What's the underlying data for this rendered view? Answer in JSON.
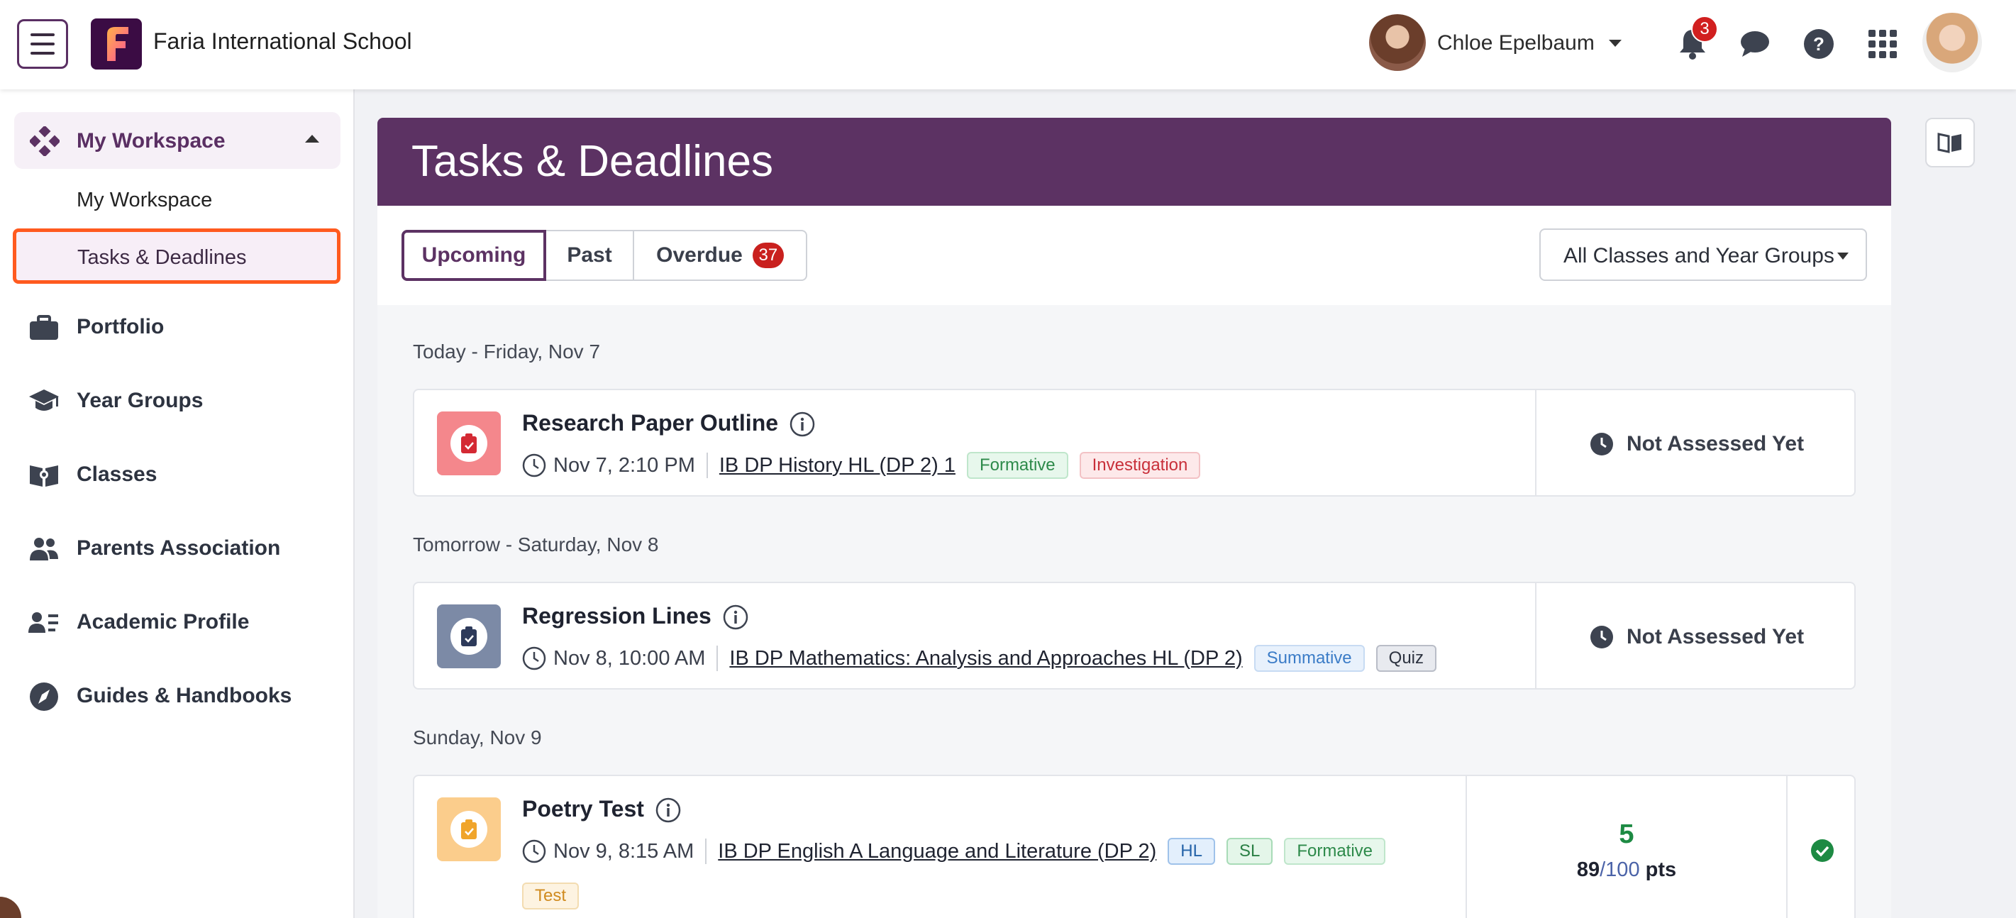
{
  "header": {
    "school_name": "Faria International School",
    "user_name": "Chloe Epelbaum",
    "notification_count": "3"
  },
  "sidebar": {
    "workspace_title": "My Workspace",
    "sub_items": [
      "My Workspace",
      "Tasks & Deadlines"
    ],
    "items": [
      {
        "label": "Portfolio",
        "icon": "briefcase-icon"
      },
      {
        "label": "Year Groups",
        "icon": "graduation-cap-icon"
      },
      {
        "label": "Classes",
        "icon": "book-open-icon"
      },
      {
        "label": "Parents Association",
        "icon": "users-icon"
      },
      {
        "label": "Academic Profile",
        "icon": "id-card-icon"
      },
      {
        "label": "Guides & Handbooks",
        "icon": "compass-icon"
      }
    ]
  },
  "page": {
    "title": "Tasks & Deadlines",
    "tabs": [
      {
        "label": "Upcoming"
      },
      {
        "label": "Past"
      },
      {
        "label": "Overdue",
        "count": "37"
      }
    ],
    "filter": "All Classes and Year Groups"
  },
  "groups": [
    {
      "day": "Today - Friday, Nov 7",
      "task": {
        "title": "Research Paper Outline",
        "time": "Nov 7, 2:10 PM",
        "class": "IB DP History HL (DP 2) 1",
        "tags": [
          "Formative",
          "Investigation"
        ],
        "status": "Not Assessed Yet"
      }
    },
    {
      "day": "Tomorrow - Saturday, Nov 8",
      "task": {
        "title": "Regression Lines",
        "time": "Nov 8, 10:00 AM",
        "class": "IB DP Mathematics: Analysis and Approaches HL (DP 2)",
        "tags": [
          "Summative",
          "Quiz"
        ],
        "status": "Not Assessed Yet"
      }
    },
    {
      "day": "Sunday, Nov 9",
      "task": {
        "title": "Poetry Test",
        "time": "Nov 9, 8:15 AM",
        "class": "IB DP English A Language and Literature (DP 2)",
        "tags": [
          "HL",
          "SL",
          "Formative",
          "Test"
        ],
        "grade": "5",
        "score": "89",
        "total": "/100",
        "pts": "pts"
      }
    }
  ],
  "colors": {
    "brand": "#5c3263",
    "highlight": "#ff5a1f",
    "badge": "#c9201e",
    "success": "#1d8a43"
  }
}
